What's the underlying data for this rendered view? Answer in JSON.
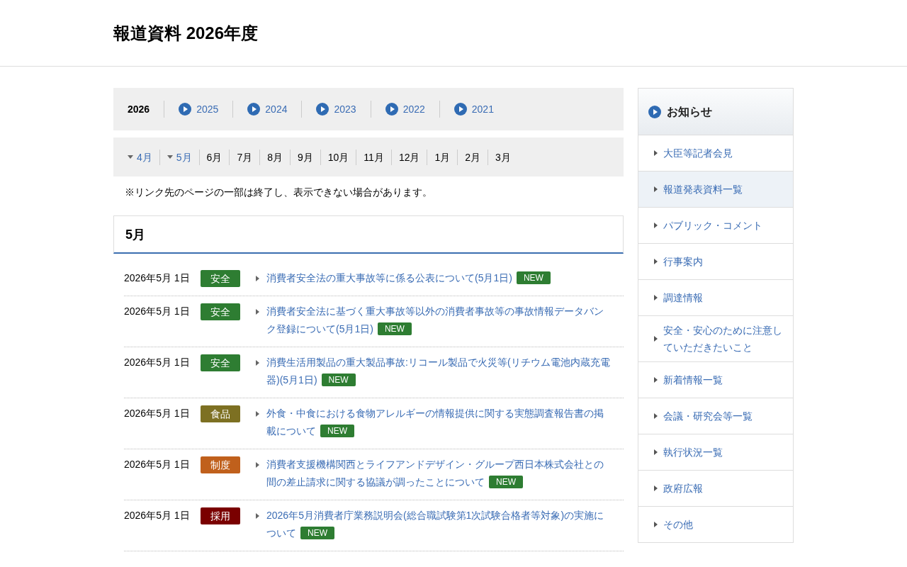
{
  "page_title": "報道資料 2026年度",
  "year_tabs": [
    {
      "label": "2026",
      "selected": true
    },
    {
      "label": "2025",
      "selected": false
    },
    {
      "label": "2024",
      "selected": false
    },
    {
      "label": "2023",
      "selected": false
    },
    {
      "label": "2022",
      "selected": false
    },
    {
      "label": "2021",
      "selected": false
    }
  ],
  "month_tabs": [
    {
      "label": "4月",
      "kind": "link"
    },
    {
      "label": "5月",
      "kind": "link"
    },
    {
      "label": "6月",
      "kind": "text"
    },
    {
      "label": "7月",
      "kind": "text"
    },
    {
      "label": "8月",
      "kind": "text"
    },
    {
      "label": "9月",
      "kind": "text"
    },
    {
      "label": "10月",
      "kind": "text"
    },
    {
      "label": "11月",
      "kind": "text"
    },
    {
      "label": "12月",
      "kind": "text"
    },
    {
      "label": "1月",
      "kind": "text"
    },
    {
      "label": "2月",
      "kind": "text"
    },
    {
      "label": "3月",
      "kind": "text"
    }
  ],
  "notice": "※リンク先のページの一部は終了し、表示できない場合があります。",
  "section": {
    "heading": "5月",
    "items": [
      {
        "date": "2026年5月 1日",
        "category": "安全",
        "color": "#2e7d32",
        "title": "消費者安全法の重大事故等に係る公表について(5月1日)",
        "new_badge": "NEW"
      },
      {
        "date": "2026年5月 1日",
        "category": "安全",
        "color": "#2e7d32",
        "title": "消費者安全法に基づく重大事故等以外の消費者事故等の事故情報データバンク登録について(5月1日)",
        "new_badge": "NEW"
      },
      {
        "date": "2026年5月 1日",
        "category": "安全",
        "color": "#2e7d32",
        "title": "消費生活用製品の重大製品事故:リコール製品で火災等(リチウム電池内蔵充電器)(5月1日)",
        "new_badge": "NEW"
      },
      {
        "date": "2026年5月 1日",
        "category": "食品",
        "color": "#7d7022",
        "title": "外食・中食における食物アレルギーの情報提供に関する実態調査報告書の掲載について",
        "new_badge": "NEW"
      },
      {
        "date": "2026年5月 1日",
        "category": "制度",
        "color": "#c0601c",
        "title": "消費者支援機構関西とライフアンドデザイン・グループ西日本株式会社との間の差止請求に関する協議が調ったことについて",
        "new_badge": "NEW"
      },
      {
        "date": "2026年5月 1日",
        "category": "採用",
        "color": "#7a0000",
        "title": "2026年5月消費者庁業務説明会(総合職試験第1次試験合格者等対象)の実施について",
        "new_badge": "NEW"
      }
    ]
  },
  "sidebar": {
    "title": "お知らせ",
    "items": [
      {
        "label": "大臣等記者会見",
        "selected": false
      },
      {
        "label": "報道発表資料一覧",
        "selected": true
      },
      {
        "label": "パブリック・コメント",
        "selected": false
      },
      {
        "label": "行事案内",
        "selected": false
      },
      {
        "label": "調達情報",
        "selected": false
      },
      {
        "label": "安全・安心のために注意していただきたいこと",
        "selected": false
      },
      {
        "label": "新着情報一覧",
        "selected": false
      },
      {
        "label": "会議・研究会等一覧",
        "selected": false
      },
      {
        "label": "執行状況一覧",
        "selected": false
      },
      {
        "label": "政府広報",
        "selected": false
      },
      {
        "label": "その他",
        "selected": false
      }
    ]
  }
}
